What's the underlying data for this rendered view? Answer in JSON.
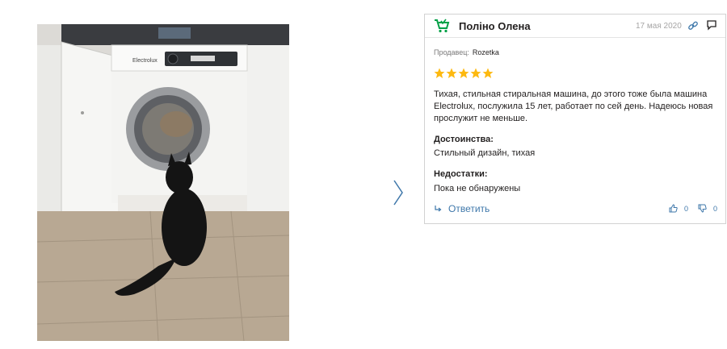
{
  "review": {
    "author": "Поліно Олена",
    "date": "17 мая 2020",
    "seller_label": "Продавец:",
    "seller_name": "Rozetka",
    "rating": 5,
    "text": "Тихая, стильная стиральная машина, до этого тоже была машина Electrolux, послужила 15 лет, работает по сей день. Надеюсь новая прослужит не меньше.",
    "advantages_label": "Достоинства:",
    "advantages": "Стильный дизайн, тихая",
    "disadvantages_label": "Недостатки:",
    "disadvantages": "Пока не обнаружены",
    "reply_label": "Ответить",
    "likes": "0",
    "dislikes": "0"
  },
  "photo": {
    "brand_text": "Electrolux"
  },
  "icons": {
    "author": "cart-icon",
    "link": "link-icon",
    "comment": "comment-icon",
    "star": "star-icon",
    "reply": "reply-arrow-icon",
    "like": "thumbs-up-icon",
    "dislike": "thumbs-down-icon",
    "next": "chevron-right-icon"
  },
  "colors": {
    "accent_link": "#3e77aa",
    "star": "#fdb910",
    "cart_green": "#00a046",
    "muted": "#a6a5a5"
  }
}
